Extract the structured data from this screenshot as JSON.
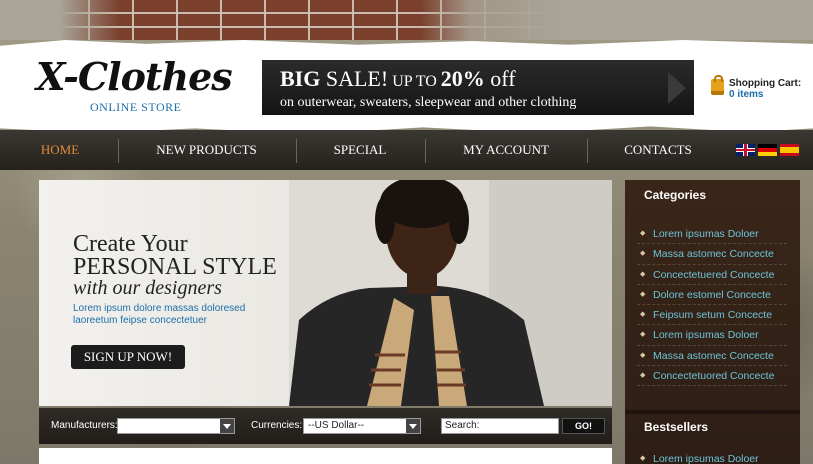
{
  "logo": {
    "main": "X-Clothes",
    "sub": "ONLINE STORE"
  },
  "banner": {
    "big": "BIG",
    "sale": " SALE!",
    "upto": " UP TO ",
    "percent": "20%",
    "off": " off",
    "line2": "on outerwear, sweaters, sleepwear and other clothing"
  },
  "cart": {
    "title": "Shopping Cart:",
    "count": "0 items"
  },
  "nav": {
    "items": [
      "HOME",
      "NEW PRODUCTS",
      "SPECIAL",
      "MY ACCOUNT",
      "CONTACTS"
    ],
    "active_color": "#e08a3c"
  },
  "flags": [
    "flag-uk-icon",
    "flag-germany-icon",
    "flag-spain-icon"
  ],
  "hero": {
    "line1": "Create Your",
    "line2": "PERSONAL STYLE",
    "line3": "with our designers",
    "text": "Lorem ipsum dolore massas doloresed laoreetum feipse concectetuer",
    "button": "SIGN UP NOW!"
  },
  "filter": {
    "manufacturers_label": "Manufacturers:",
    "manufacturers_value": "",
    "currencies_label": "Currencies:",
    "currency_value": "--US Dollar--",
    "search_label": "Search:",
    "go": "GO!"
  },
  "sidebar": {
    "categories_title": "Categories",
    "categories": [
      "Lorem ipsumas Doloer",
      "Massa astomec Concecte",
      "Concectetuered Concecte",
      "Dolore estomel Concecte",
      "Feipsum setum Concecte",
      "Lorem ipsumas Doloer",
      "Massa astomec Concecte",
      "Concectetuored Concecte"
    ],
    "bestsellers_title": "Bestsellers",
    "bestsellers": [
      "Lorem ipsumas Doloer"
    ]
  },
  "colors": {
    "link": "#6ec3d8",
    "accent": "#1d6fa9",
    "sidebar_bg": "#3a2619"
  }
}
